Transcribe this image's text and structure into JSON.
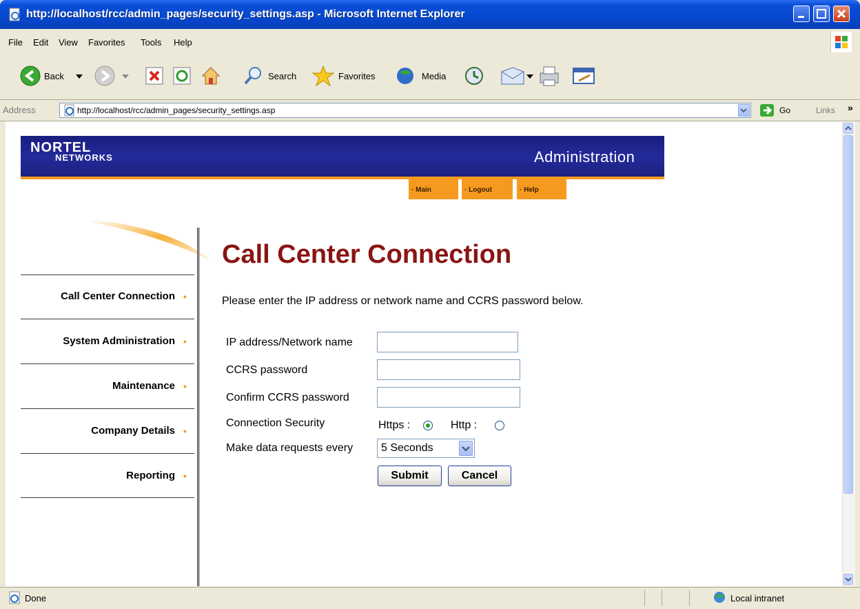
{
  "window": {
    "title": "http://localhost/rcc/admin_pages/security_settings.asp - Microsoft Internet Explorer"
  },
  "menu": [
    "File",
    "Edit",
    "View",
    "Favorites",
    "Tools",
    "Help"
  ],
  "toolbar": {
    "back": "Back",
    "search": "Search",
    "favorites": "Favorites",
    "media": "Media"
  },
  "address": {
    "label": "Address",
    "url": "http://localhost/rcc/admin_pages/security_settings.asp",
    "go": "Go",
    "links": "Links"
  },
  "status": {
    "text": "Done",
    "zone": "Local intranet"
  },
  "banner": {
    "logo_line1": "NORTEL",
    "logo_line2": "NETWORKS",
    "section": "Administration"
  },
  "topnav": [
    "Main",
    "Logout",
    "Help"
  ],
  "sidebar": [
    "Call Center Connection",
    "System Administration",
    "Maintenance",
    "Company Details",
    "Reporting"
  ],
  "page": {
    "title": "Call Center Connection",
    "instructions": "Please enter the IP address or network name and CCRS password below."
  },
  "form": {
    "ip_label": "IP address/Network name",
    "ip_value": "",
    "password_label": "CCRS password",
    "password_value": "",
    "confirm_label": "Confirm CCRS password",
    "confirm_value": "",
    "security_label": "Connection Security",
    "https_label": "Https :",
    "http_label": "Http :",
    "selected_protocol": "Https",
    "interval_label": "Make data requests every",
    "interval_value": "5 Seconds",
    "submit": "Submit",
    "cancel": "Cancel"
  },
  "colors": {
    "banner": "#232a9a",
    "accent": "#f59a1e",
    "title": "#8a1414"
  }
}
